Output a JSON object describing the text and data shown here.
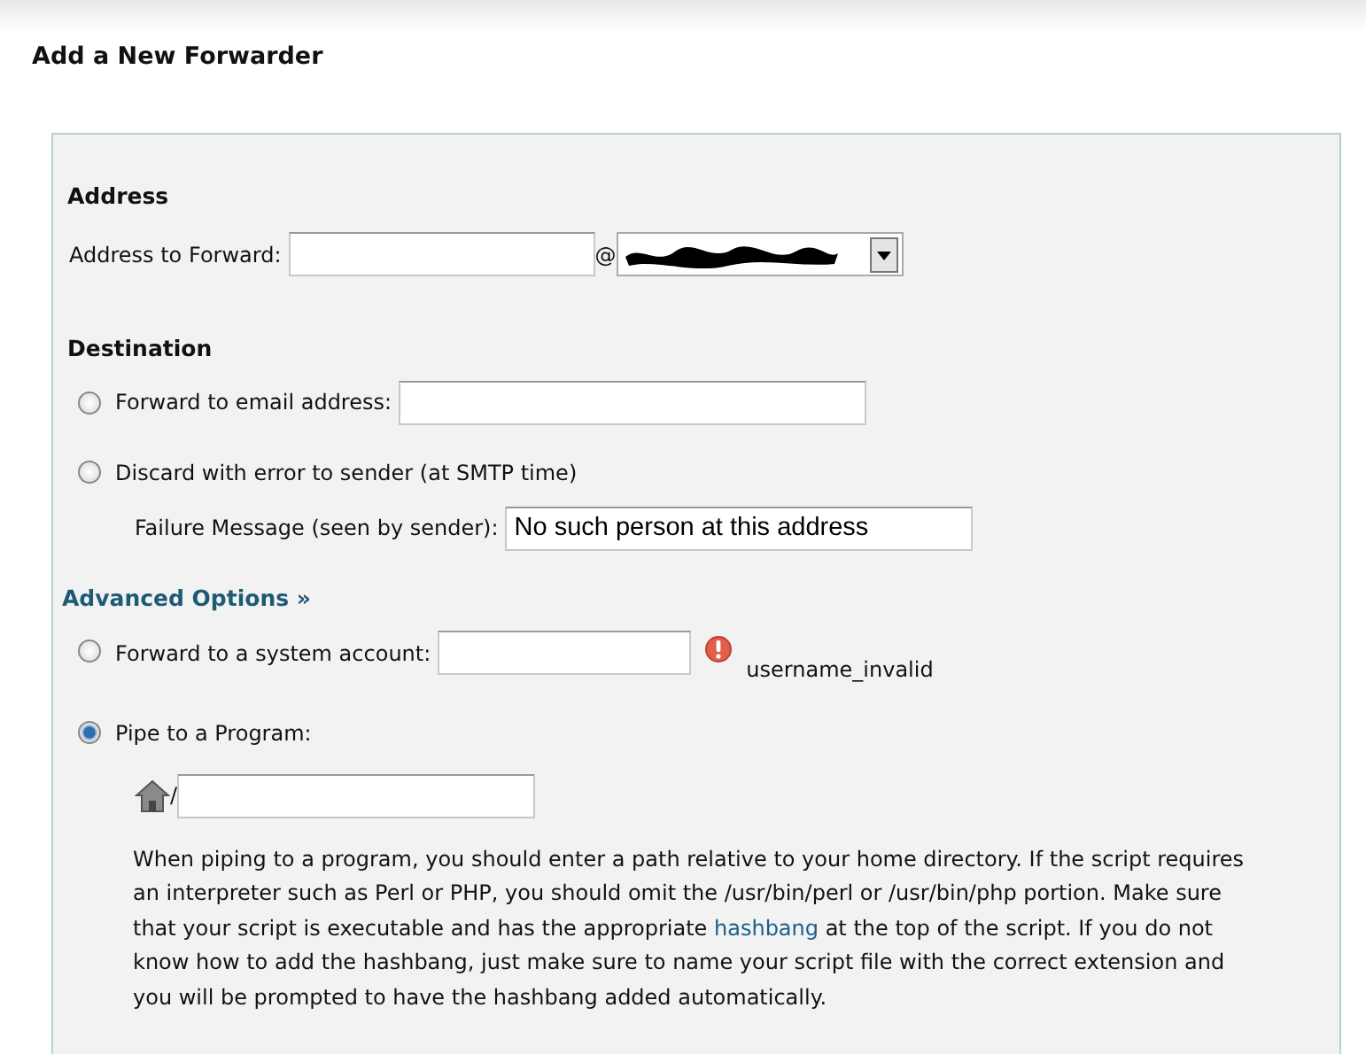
{
  "title": "Add a New Forwarder",
  "address": {
    "heading": "Address",
    "label": "Address to Forward:",
    "at": "@"
  },
  "destination": {
    "heading": "Destination",
    "options": [
      {
        "kind": "field",
        "label": "Forward to email address:",
        "selected": false
      },
      {
        "kind": "discard",
        "label": "Discard with error to sender (at SMTP time)",
        "selected": false,
        "sub_label": "Failure Message (seen by sender):",
        "sub_value": "No such person at this address"
      }
    ]
  },
  "advanced": {
    "link": "Advanced Options",
    "chevron": "»",
    "options": [
      {
        "kind": "field",
        "label": "Forward to a system account:",
        "selected": false,
        "error": "username_invalid"
      },
      {
        "kind": "pipe",
        "label": "Pipe to a Program:",
        "selected": true,
        "slash": "/",
        "help_before": "When piping to a program, you should enter a path relative to your home directory. If the script requires an interpreter such as Perl or PHP, you should omit the /usr/bin/perl or /usr/bin/php portion. Make sure that your script is executable and has the appropriate",
        "help_link": "hashbang",
        "help_after": "at the top of the script. If you do not know how to add the hashbang, just make sure to name your script file with the correct extension and you will be prompted to have the hashbang added automatically."
      }
    ]
  }
}
